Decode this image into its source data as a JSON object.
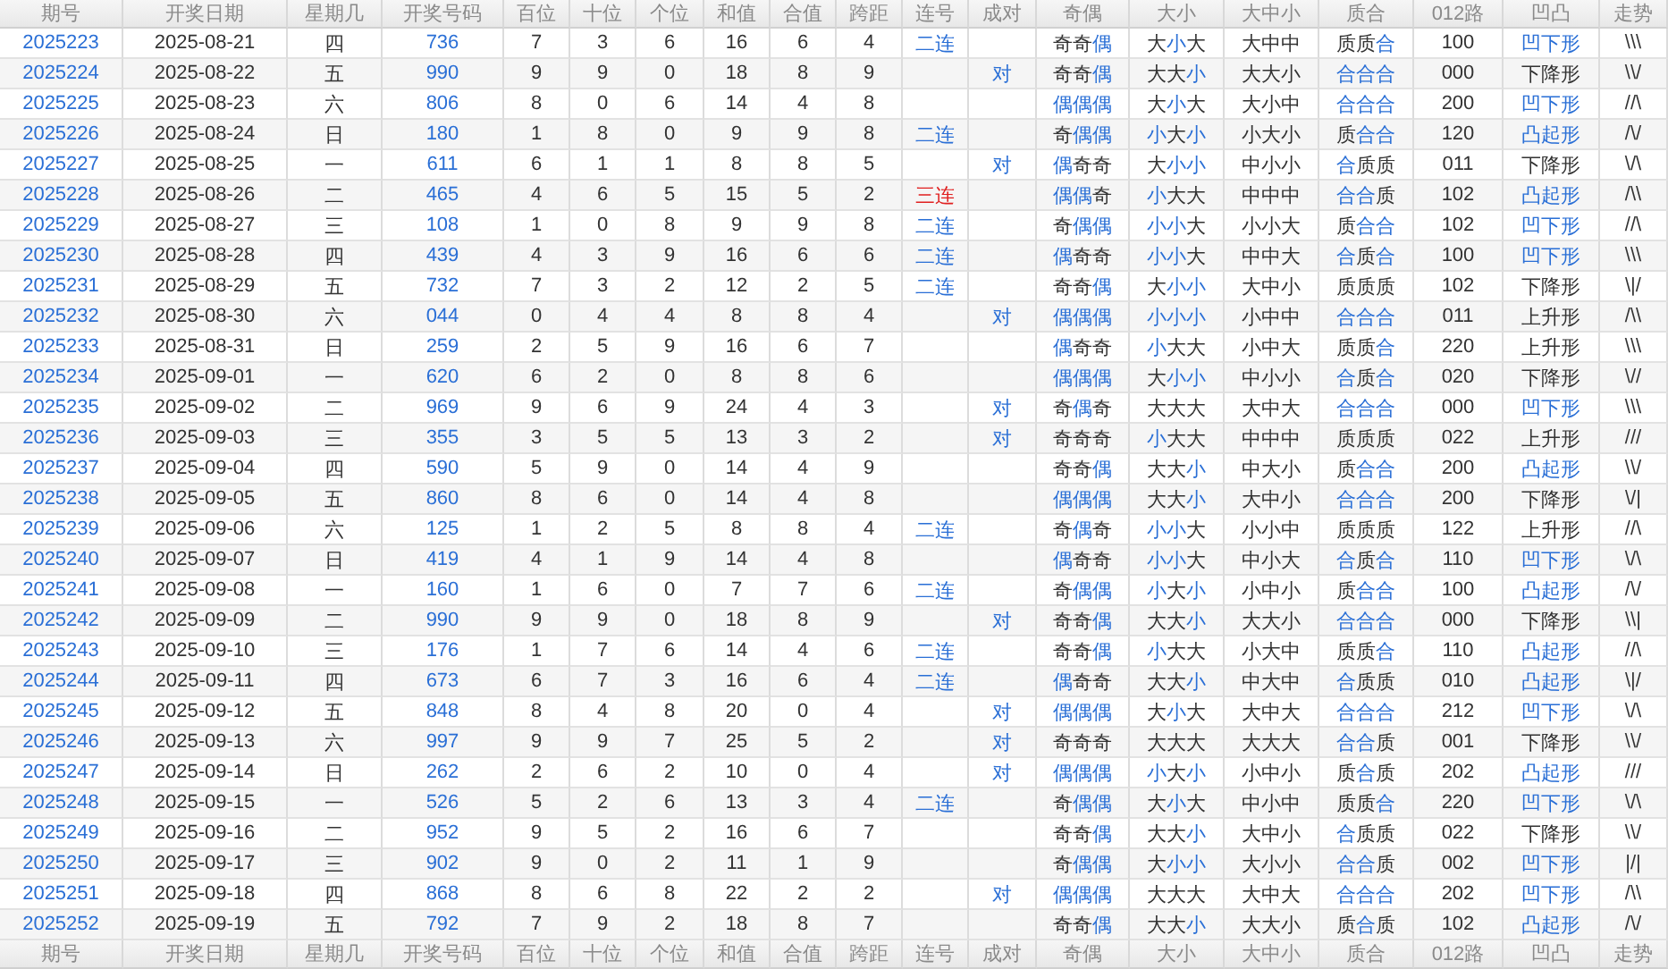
{
  "columns": [
    "期号",
    "开奖日期",
    "星期几",
    "开奖号码",
    "百位",
    "十位",
    "个位",
    "和值",
    "合值",
    "跨距",
    "连号",
    "成对",
    "奇偶",
    "大小",
    "大中小",
    "质合",
    "012路",
    "凹凸",
    "走势"
  ],
  "rows": [
    {
      "issue": "2025223",
      "date": "2025-08-21",
      "weekday": "四",
      "number": "736",
      "hundreds": "7",
      "tens": "3",
      "units": "6",
      "sum": "16",
      "sum_digit": "6",
      "span": "4",
      "streak": {
        "text": "二连",
        "color": "#2a6fd6"
      },
      "parity": "奇奇偶",
      "parity_marked": [
        false,
        false,
        true
      ],
      "size": "大小大",
      "size_marked": [
        false,
        true,
        false
      ],
      "size3": "大中中",
      "prime": "质质合",
      "prime_marked": [
        false,
        false,
        true
      ],
      "road": "100",
      "shape": "凹下形",
      "shape_marked": true,
      "trend": "\\\\\\"
    },
    {
      "issue": "2025224",
      "date": "2025-08-22",
      "weekday": "五",
      "number": "990",
      "hundreds": "9",
      "tens": "9",
      "units": "0",
      "sum": "18",
      "sum_digit": "8",
      "span": "9",
      "pair": "对",
      "parity": "奇奇偶",
      "parity_marked": [
        false,
        false,
        true
      ],
      "size": "大大小",
      "size_marked": [
        false,
        false,
        true
      ],
      "size3": "大大小",
      "prime": "合合合",
      "prime_marked": [
        true,
        true,
        true
      ],
      "road": "000",
      "shape": "下降形",
      "shape_marked": false,
      "trend": "\\\\/"
    },
    {
      "issue": "2025225",
      "date": "2025-08-23",
      "weekday": "六",
      "number": "806",
      "hundreds": "8",
      "tens": "0",
      "units": "6",
      "sum": "14",
      "sum_digit": "4",
      "span": "8",
      "parity": "偶偶偶",
      "parity_marked": [
        true,
        true,
        true
      ],
      "size": "大小大",
      "size_marked": [
        false,
        true,
        false
      ],
      "size3": "大小中",
      "prime": "合合合",
      "prime_marked": [
        true,
        true,
        true
      ],
      "road": "200",
      "shape": "凹下形",
      "shape_marked": true,
      "trend": "//\\"
    },
    {
      "issue": "2025226",
      "date": "2025-08-24",
      "weekday": "日",
      "number": "180",
      "hundreds": "1",
      "tens": "8",
      "units": "0",
      "sum": "9",
      "sum_digit": "9",
      "span": "8",
      "streak": {
        "text": "二连",
        "color": "#2a6fd6"
      },
      "parity": "奇偶偶",
      "parity_marked": [
        false,
        true,
        true
      ],
      "size": "小大小",
      "size_marked": [
        true,
        false,
        true
      ],
      "size3": "小大小",
      "prime": "质合合",
      "prime_marked": [
        false,
        true,
        true
      ],
      "road": "120",
      "shape": "凸起形",
      "shape_marked": true,
      "trend": "/\\/"
    },
    {
      "issue": "2025227",
      "date": "2025-08-25",
      "weekday": "一",
      "number": "611",
      "hundreds": "6",
      "tens": "1",
      "units": "1",
      "sum": "8",
      "sum_digit": "8",
      "span": "5",
      "pair": "对",
      "parity": "偶奇奇",
      "parity_marked": [
        true,
        false,
        false
      ],
      "size": "大小小",
      "size_marked": [
        false,
        true,
        true
      ],
      "size3": "中小小",
      "prime": "合质质",
      "prime_marked": [
        true,
        false,
        false
      ],
      "road": "011",
      "shape": "下降形",
      "shape_marked": false,
      "trend": "\\/\\"
    },
    {
      "issue": "2025228",
      "date": "2025-08-26",
      "weekday": "二",
      "number": "465",
      "hundreds": "4",
      "tens": "6",
      "units": "5",
      "sum": "15",
      "sum_digit": "5",
      "span": "2",
      "streak": {
        "text": "三连",
        "color": "#e02020"
      },
      "parity": "偶偶奇",
      "parity_marked": [
        true,
        true,
        false
      ],
      "size": "小大大",
      "size_marked": [
        true,
        false,
        false
      ],
      "size3": "中中中",
      "prime": "合合质",
      "prime_marked": [
        true,
        true,
        false
      ],
      "road": "102",
      "shape": "凸起形",
      "shape_marked": true,
      "trend": "/\\\\"
    },
    {
      "issue": "2025229",
      "date": "2025-08-27",
      "weekday": "三",
      "number": "108",
      "hundreds": "1",
      "tens": "0",
      "units": "8",
      "sum": "9",
      "sum_digit": "9",
      "span": "8",
      "streak": {
        "text": "二连",
        "color": "#2a6fd6"
      },
      "parity": "奇偶偶",
      "parity_marked": [
        false,
        true,
        true
      ],
      "size": "小小大",
      "size_marked": [
        true,
        true,
        false
      ],
      "size3": "小小大",
      "prime": "质合合",
      "prime_marked": [
        false,
        true,
        true
      ],
      "road": "102",
      "shape": "凹下形",
      "shape_marked": true,
      "trend": "//\\"
    },
    {
      "issue": "2025230",
      "date": "2025-08-28",
      "weekday": "四",
      "number": "439",
      "hundreds": "4",
      "tens": "3",
      "units": "9",
      "sum": "16",
      "sum_digit": "6",
      "span": "6",
      "streak": {
        "text": "二连",
        "color": "#2a6fd6"
      },
      "parity": "偶奇奇",
      "parity_marked": [
        true,
        false,
        false
      ],
      "size": "小小大",
      "size_marked": [
        true,
        true,
        false
      ],
      "size3": "中中大",
      "prime": "合质合",
      "prime_marked": [
        true,
        false,
        true
      ],
      "road": "100",
      "shape": "凹下形",
      "shape_marked": true,
      "trend": "\\\\\\"
    },
    {
      "issue": "2025231",
      "date": "2025-08-29",
      "weekday": "五",
      "number": "732",
      "hundreds": "7",
      "tens": "3",
      "units": "2",
      "sum": "12",
      "sum_digit": "2",
      "span": "5",
      "streak": {
        "text": "二连",
        "color": "#2a6fd6"
      },
      "parity": "奇奇偶",
      "parity_marked": [
        false,
        false,
        true
      ],
      "size": "大小小",
      "size_marked": [
        false,
        true,
        true
      ],
      "size3": "大中小",
      "prime": "质质质",
      "prime_marked": [
        false,
        false,
        false
      ],
      "road": "102",
      "shape": "下降形",
      "shape_marked": false,
      "trend": "\\|/"
    },
    {
      "issue": "2025232",
      "date": "2025-08-30",
      "weekday": "六",
      "number": "044",
      "hundreds": "0",
      "tens": "4",
      "units": "4",
      "sum": "8",
      "sum_digit": "8",
      "span": "4",
      "pair": "对",
      "parity": "偶偶偶",
      "parity_marked": [
        true,
        true,
        true
      ],
      "size": "小小小",
      "size_marked": [
        true,
        true,
        true
      ],
      "size3": "小中中",
      "prime": "合合合",
      "prime_marked": [
        true,
        true,
        true
      ],
      "road": "011",
      "shape": "上升形",
      "shape_marked": false,
      "trend": "/\\\\"
    },
    {
      "issue": "2025233",
      "date": "2025-08-31",
      "weekday": "日",
      "number": "259",
      "hundreds": "2",
      "tens": "5",
      "units": "9",
      "sum": "16",
      "sum_digit": "6",
      "span": "7",
      "parity": "偶奇奇",
      "parity_marked": [
        true,
        false,
        false
      ],
      "size": "小大大",
      "size_marked": [
        true,
        false,
        false
      ],
      "size3": "小中大",
      "prime": "质质合",
      "prime_marked": [
        false,
        false,
        true
      ],
      "road": "220",
      "shape": "上升形",
      "shape_marked": false,
      "trend": "\\\\\\"
    },
    {
      "issue": "2025234",
      "date": "2025-09-01",
      "weekday": "一",
      "number": "620",
      "hundreds": "6",
      "tens": "2",
      "units": "0",
      "sum": "8",
      "sum_digit": "8",
      "span": "6",
      "parity": "偶偶偶",
      "parity_marked": [
        true,
        true,
        true
      ],
      "size": "大小小",
      "size_marked": [
        false,
        true,
        true
      ],
      "size3": "中小小",
      "prime": "合质合",
      "prime_marked": [
        true,
        false,
        true
      ],
      "road": "020",
      "shape": "下降形",
      "shape_marked": false,
      "trend": "\\//"
    },
    {
      "issue": "2025235",
      "date": "2025-09-02",
      "weekday": "二",
      "number": "969",
      "hundreds": "9",
      "tens": "6",
      "units": "9",
      "sum": "24",
      "sum_digit": "4",
      "span": "3",
      "pair": "对",
      "parity": "奇偶奇",
      "parity_marked": [
        false,
        true,
        false
      ],
      "size": "大大大",
      "size_marked": [
        false,
        false,
        false
      ],
      "size3": "大中大",
      "prime": "合合合",
      "prime_marked": [
        true,
        true,
        true
      ],
      "road": "000",
      "shape": "凹下形",
      "shape_marked": true,
      "trend": "\\\\\\"
    },
    {
      "issue": "2025236",
      "date": "2025-09-03",
      "weekday": "三",
      "number": "355",
      "hundreds": "3",
      "tens": "5",
      "units": "5",
      "sum": "13",
      "sum_digit": "3",
      "span": "2",
      "pair": "对",
      "parity": "奇奇奇",
      "parity_marked": [
        false,
        false,
        false
      ],
      "size": "小大大",
      "size_marked": [
        true,
        false,
        false
      ],
      "size3": "中中中",
      "prime": "质质质",
      "prime_marked": [
        false,
        false,
        false
      ],
      "road": "022",
      "shape": "上升形",
      "shape_marked": false,
      "trend": "///"
    },
    {
      "issue": "2025237",
      "date": "2025-09-04",
      "weekday": "四",
      "number": "590",
      "hundreds": "5",
      "tens": "9",
      "units": "0",
      "sum": "14",
      "sum_digit": "4",
      "span": "9",
      "parity": "奇奇偶",
      "parity_marked": [
        false,
        false,
        true
      ],
      "size": "大大小",
      "size_marked": [
        false,
        false,
        true
      ],
      "size3": "中大小",
      "prime": "质合合",
      "prime_marked": [
        false,
        true,
        true
      ],
      "road": "200",
      "shape": "凸起形",
      "shape_marked": true,
      "trend": "\\\\/"
    },
    {
      "issue": "2025238",
      "date": "2025-09-05",
      "weekday": "五",
      "number": "860",
      "hundreds": "8",
      "tens": "6",
      "units": "0",
      "sum": "14",
      "sum_digit": "4",
      "span": "8",
      "parity": "偶偶偶",
      "parity_marked": [
        true,
        true,
        true
      ],
      "size": "大大小",
      "size_marked": [
        false,
        false,
        true
      ],
      "size3": "大中小",
      "prime": "合合合",
      "prime_marked": [
        true,
        true,
        true
      ],
      "road": "200",
      "shape": "下降形",
      "shape_marked": false,
      "trend": "\\/|"
    },
    {
      "issue": "2025239",
      "date": "2025-09-06",
      "weekday": "六",
      "number": "125",
      "hundreds": "1",
      "tens": "2",
      "units": "5",
      "sum": "8",
      "sum_digit": "8",
      "span": "4",
      "streak": {
        "text": "二连",
        "color": "#2a6fd6"
      },
      "parity": "奇偶奇",
      "parity_marked": [
        false,
        true,
        false
      ],
      "size": "小小大",
      "size_marked": [
        true,
        true,
        false
      ],
      "size3": "小小中",
      "prime": "质质质",
      "prime_marked": [
        false,
        false,
        false
      ],
      "road": "122",
      "shape": "上升形",
      "shape_marked": false,
      "trend": "//\\"
    },
    {
      "issue": "2025240",
      "date": "2025-09-07",
      "weekday": "日",
      "number": "419",
      "hundreds": "4",
      "tens": "1",
      "units": "9",
      "sum": "14",
      "sum_digit": "4",
      "span": "8",
      "parity": "偶奇奇",
      "parity_marked": [
        true,
        false,
        false
      ],
      "size": "小小大",
      "size_marked": [
        true,
        true,
        false
      ],
      "size3": "中小大",
      "prime": "合质合",
      "prime_marked": [
        true,
        false,
        true
      ],
      "road": "110",
      "shape": "凹下形",
      "shape_marked": true,
      "trend": "\\/\\"
    },
    {
      "issue": "2025241",
      "date": "2025-09-08",
      "weekday": "一",
      "number": "160",
      "hundreds": "1",
      "tens": "6",
      "units": "0",
      "sum": "7",
      "sum_digit": "7",
      "span": "6",
      "streak": {
        "text": "二连",
        "color": "#2a6fd6"
      },
      "parity": "奇偶偶",
      "parity_marked": [
        false,
        true,
        true
      ],
      "size": "小大小",
      "size_marked": [
        true,
        false,
        true
      ],
      "size3": "小中小",
      "prime": "质合合",
      "prime_marked": [
        false,
        true,
        true
      ],
      "road": "100",
      "shape": "凸起形",
      "shape_marked": true,
      "trend": "/\\/"
    },
    {
      "issue": "2025242",
      "date": "2025-09-09",
      "weekday": "二",
      "number": "990",
      "hundreds": "9",
      "tens": "9",
      "units": "0",
      "sum": "18",
      "sum_digit": "8",
      "span": "9",
      "pair": "对",
      "parity": "奇奇偶",
      "parity_marked": [
        false,
        false,
        true
      ],
      "size": "大大小",
      "size_marked": [
        false,
        false,
        true
      ],
      "size3": "大大小",
      "prime": "合合合",
      "prime_marked": [
        true,
        true,
        true
      ],
      "road": "000",
      "shape": "下降形",
      "shape_marked": false,
      "trend": "\\\\|"
    },
    {
      "issue": "2025243",
      "date": "2025-09-10",
      "weekday": "三",
      "number": "176",
      "hundreds": "1",
      "tens": "7",
      "units": "6",
      "sum": "14",
      "sum_digit": "4",
      "span": "6",
      "streak": {
        "text": "二连",
        "color": "#2a6fd6"
      },
      "parity": "奇奇偶",
      "parity_marked": [
        false,
        false,
        true
      ],
      "size": "小大大",
      "size_marked": [
        true,
        false,
        false
      ],
      "size3": "小大中",
      "prime": "质质合",
      "prime_marked": [
        false,
        false,
        true
      ],
      "road": "110",
      "shape": "凸起形",
      "shape_marked": true,
      "trend": "//\\"
    },
    {
      "issue": "2025244",
      "date": "2025-09-11",
      "weekday": "四",
      "number": "673",
      "hundreds": "6",
      "tens": "7",
      "units": "3",
      "sum": "16",
      "sum_digit": "6",
      "span": "4",
      "streak": {
        "text": "二连",
        "color": "#2a6fd6"
      },
      "parity": "偶奇奇",
      "parity_marked": [
        true,
        false,
        false
      ],
      "size": "大大小",
      "size_marked": [
        false,
        false,
        true
      ],
      "size3": "中大中",
      "prime": "合质质",
      "prime_marked": [
        true,
        false,
        false
      ],
      "road": "010",
      "shape": "凸起形",
      "shape_marked": true,
      "trend": "\\|/"
    },
    {
      "issue": "2025245",
      "date": "2025-09-12",
      "weekday": "五",
      "number": "848",
      "hundreds": "8",
      "tens": "4",
      "units": "8",
      "sum": "20",
      "sum_digit": "0",
      "span": "4",
      "pair": "对",
      "parity": "偶偶偶",
      "parity_marked": [
        true,
        true,
        true
      ],
      "size": "大小大",
      "size_marked": [
        false,
        true,
        false
      ],
      "size3": "大中大",
      "prime": "合合合",
      "prime_marked": [
        true,
        true,
        true
      ],
      "road": "212",
      "shape": "凹下形",
      "shape_marked": true,
      "trend": "\\/\\"
    },
    {
      "issue": "2025246",
      "date": "2025-09-13",
      "weekday": "六",
      "number": "997",
      "hundreds": "9",
      "tens": "9",
      "units": "7",
      "sum": "25",
      "sum_digit": "5",
      "span": "2",
      "pair": "对",
      "parity": "奇奇奇",
      "parity_marked": [
        false,
        false,
        false
      ],
      "size": "大大大",
      "size_marked": [
        false,
        false,
        false
      ],
      "size3": "大大大",
      "prime": "合合质",
      "prime_marked": [
        true,
        true,
        false
      ],
      "road": "001",
      "shape": "下降形",
      "shape_marked": false,
      "trend": "\\\\/"
    },
    {
      "issue": "2025247",
      "date": "2025-09-14",
      "weekday": "日",
      "number": "262",
      "hundreds": "2",
      "tens": "6",
      "units": "2",
      "sum": "10",
      "sum_digit": "0",
      "span": "4",
      "pair": "对",
      "parity": "偶偶偶",
      "parity_marked": [
        true,
        true,
        true
      ],
      "size": "小大小",
      "size_marked": [
        true,
        false,
        true
      ],
      "size3": "小中小",
      "prime": "质合质",
      "prime_marked": [
        false,
        true,
        false
      ],
      "road": "202",
      "shape": "凸起形",
      "shape_marked": true,
      "trend": "///"
    },
    {
      "issue": "2025248",
      "date": "2025-09-15",
      "weekday": "一",
      "number": "526",
      "hundreds": "5",
      "tens": "2",
      "units": "6",
      "sum": "13",
      "sum_digit": "3",
      "span": "4",
      "streak": {
        "text": "二连",
        "color": "#2a6fd6"
      },
      "parity": "奇偶偶",
      "parity_marked": [
        false,
        true,
        true
      ],
      "size": "大小大",
      "size_marked": [
        false,
        true,
        false
      ],
      "size3": "中小中",
      "prime": "质质合",
      "prime_marked": [
        false,
        false,
        true
      ],
      "road": "220",
      "shape": "凹下形",
      "shape_marked": true,
      "trend": "\\/\\"
    },
    {
      "issue": "2025249",
      "date": "2025-09-16",
      "weekday": "二",
      "number": "952",
      "hundreds": "9",
      "tens": "5",
      "units": "2",
      "sum": "16",
      "sum_digit": "6",
      "span": "7",
      "parity": "奇奇偶",
      "parity_marked": [
        false,
        false,
        true
      ],
      "size": "大大小",
      "size_marked": [
        false,
        false,
        true
      ],
      "size3": "大中小",
      "prime": "合质质",
      "prime_marked": [
        true,
        false,
        false
      ],
      "road": "022",
      "shape": "下降形",
      "shape_marked": false,
      "trend": "\\\\/"
    },
    {
      "issue": "2025250",
      "date": "2025-09-17",
      "weekday": "三",
      "number": "902",
      "hundreds": "9",
      "tens": "0",
      "units": "2",
      "sum": "11",
      "sum_digit": "1",
      "span": "9",
      "parity": "奇偶偶",
      "parity_marked": [
        false,
        true,
        true
      ],
      "size": "大小小",
      "size_marked": [
        false,
        true,
        true
      ],
      "size3": "大小小",
      "prime": "合合质",
      "prime_marked": [
        true,
        true,
        false
      ],
      "road": "002",
      "shape": "凹下形",
      "shape_marked": true,
      "trend": "|/|"
    },
    {
      "issue": "2025251",
      "date": "2025-09-18",
      "weekday": "四",
      "number": "868",
      "hundreds": "8",
      "tens": "6",
      "units": "8",
      "sum": "22",
      "sum_digit": "2",
      "span": "2",
      "pair": "对",
      "parity": "偶偶偶",
      "parity_marked": [
        true,
        true,
        true
      ],
      "size": "大大大",
      "size_marked": [
        false,
        false,
        false
      ],
      "size3": "大中大",
      "prime": "合合合",
      "prime_marked": [
        true,
        true,
        true
      ],
      "road": "202",
      "shape": "凹下形",
      "shape_marked": true,
      "trend": "/\\\\"
    },
    {
      "issue": "2025252",
      "date": "2025-09-19",
      "weekday": "五",
      "number": "792",
      "hundreds": "7",
      "tens": "9",
      "units": "2",
      "sum": "18",
      "sum_digit": "8",
      "span": "7",
      "parity": "奇奇偶",
      "parity_marked": [
        false,
        false,
        true
      ],
      "size": "大大小",
      "size_marked": [
        false,
        false,
        true
      ],
      "size3": "大大小",
      "prime": "质合质",
      "prime_marked": [
        false,
        true,
        false
      ],
      "road": "102",
      "shape": "凸起形",
      "shape_marked": true,
      "trend": "/\\/"
    }
  ],
  "footer_columns": [
    "期号",
    "开奖日期",
    "星期几",
    "开奖号码",
    "百位",
    "十位",
    "个位",
    "和值",
    "合值",
    "跨距",
    "连号",
    "成对",
    "奇偶",
    "大小",
    "大中小",
    "质合",
    "012路",
    "凹凸",
    "走势"
  ]
}
